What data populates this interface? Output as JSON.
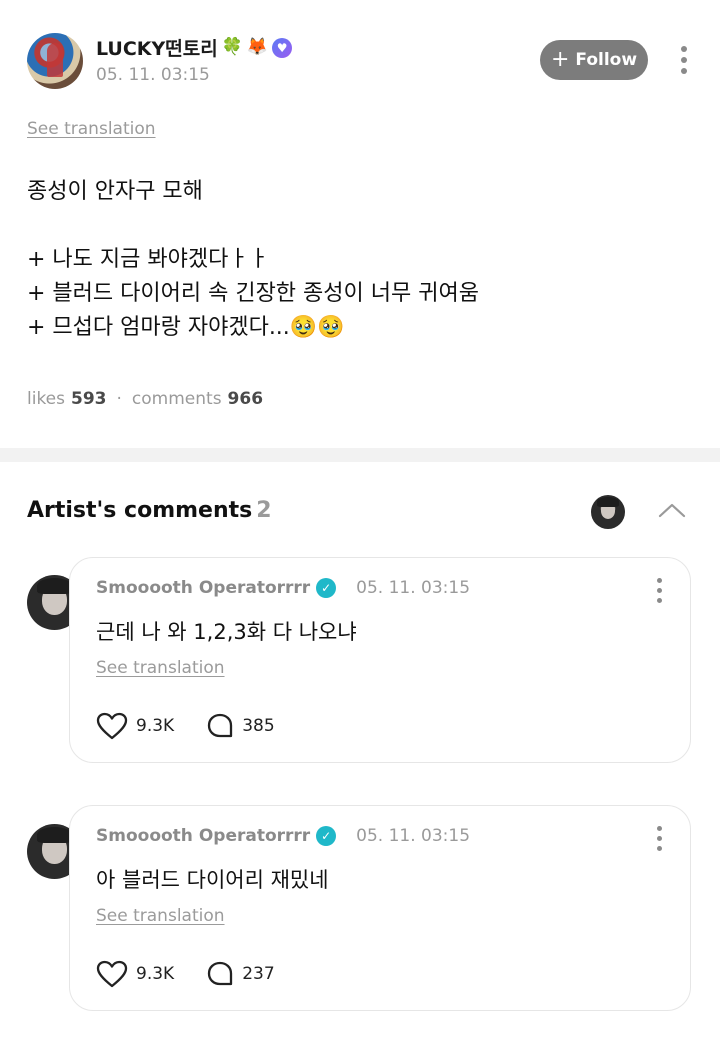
{
  "post": {
    "author": "LUCKY떤토리",
    "author_emojis": [
      "🍀",
      "🦊"
    ],
    "verified_mark": "♥",
    "time": "05. 11. 03:15",
    "follow_label": "Follow",
    "see_translation": "See translation",
    "body_lines": [
      "종성이 안자구 모해",
      "",
      "+ 나도 지금 봐야겠다ㅏㅏ",
      "+ 블러드 다이어리 속 긴장한 종성이 너무 귀여움",
      "+ 므섭다 엄마랑 자야겠다...🥹🥹"
    ],
    "likes_label": "likes",
    "likes_count": "593",
    "separator": "·",
    "comments_label": "comments",
    "comments_count": "966"
  },
  "artist_comments": {
    "title": "Artist's comments",
    "count": "2",
    "items": [
      {
        "name": "Smooooth Operatorrrr",
        "verified_mark": "✓",
        "time": "05. 11. 03:15",
        "text": "근데 나 와 1,2,3화 다 나오냐",
        "see_translation": "See translation",
        "likes": "9.3K",
        "replies": "385"
      },
      {
        "name": "Smooooth Operatorrrr",
        "verified_mark": "✓",
        "time": "05. 11. 03:15",
        "text": "아 블러드 다이어리 재밌네",
        "see_translation": "See translation",
        "likes": "9.3K",
        "replies": "237"
      }
    ]
  },
  "colors": {
    "follow_bg": "#7c7c7c",
    "verified_teal": "#1fb8c9",
    "verified_purple": "#7a6cf2",
    "muted_text": "#9a9a9a"
  },
  "icons": [
    "more-vertical-icon",
    "heart-icon",
    "comment-bubble-icon",
    "chevron-up-icon",
    "verified-badge-icon"
  ]
}
